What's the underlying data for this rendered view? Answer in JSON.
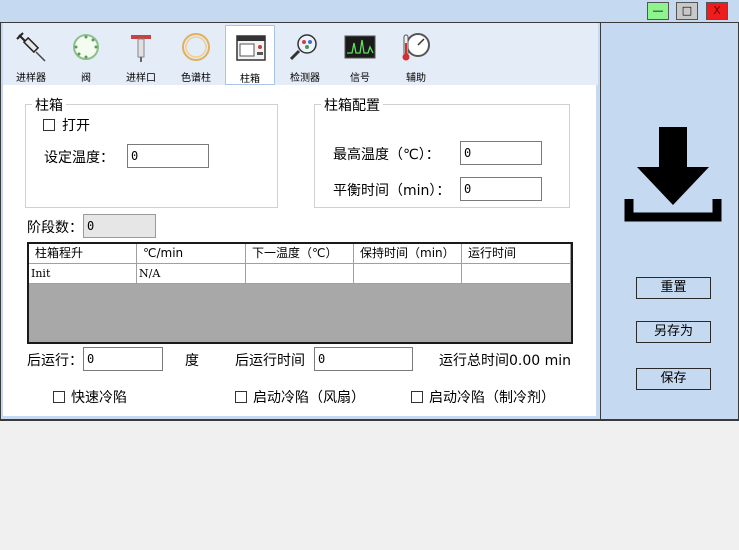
{
  "window": {
    "min_glyph": "—",
    "max_glyph": "□",
    "close_glyph": "X"
  },
  "toolbar": {
    "items": [
      {
        "label": "进样器",
        "icon": "syringe-icon",
        "active": false
      },
      {
        "label": "阀",
        "icon": "valve-icon",
        "active": false
      },
      {
        "label": "进样口",
        "icon": "inlet-icon",
        "active": false
      },
      {
        "label": "色谱柱",
        "icon": "column-icon",
        "active": false
      },
      {
        "label": "柱箱",
        "icon": "oven-icon",
        "active": true
      },
      {
        "label": "检测器",
        "icon": "detector-icon",
        "active": false
      },
      {
        "label": "信号",
        "icon": "signal-icon",
        "active": false
      },
      {
        "label": "辅助",
        "icon": "auxiliary-icon",
        "active": false
      }
    ]
  },
  "oven": {
    "group_title": "柱箱",
    "open_label": "打开",
    "open_checked": false,
    "setpoint_label": "设定温度：",
    "setpoint_value": "0"
  },
  "config": {
    "group_title": "柱箱配置",
    "max_temp_label": "最高温度（℃）：",
    "max_temp_value": "0",
    "equil_label": "平衡时间（min）：",
    "equil_value": "0"
  },
  "stages": {
    "label": "阶段数：",
    "value": "0"
  },
  "ramp_table": {
    "headers": [
      "柱箱程升",
      "℃/min",
      "下一温度（℃）",
      "保持时间（min）",
      "运行时间"
    ],
    "rows": [
      [
        "Init",
        "N/A",
        "",
        "",
        ""
      ]
    ]
  },
  "post_run": {
    "label": "后运行：",
    "value": "0",
    "unit": "度",
    "time_label": "后运行时间",
    "time_value": "0",
    "total_label": "运行总时间0.00 min"
  },
  "options": {
    "fast_cool": "快速冷陷",
    "fan_cool": "启动冷陷（风扇）",
    "coolant_cool": "启动冷陷（制冷剂）"
  },
  "side": {
    "download_icon": "download-icon",
    "reset": "重置",
    "save_as": "另存为",
    "save": "保存"
  },
  "colors": {
    "panel": "#c5d9f1",
    "toolbar": "#e4ecf7",
    "min_button": "#8ef58e",
    "close_button": "#ee1c1c"
  }
}
